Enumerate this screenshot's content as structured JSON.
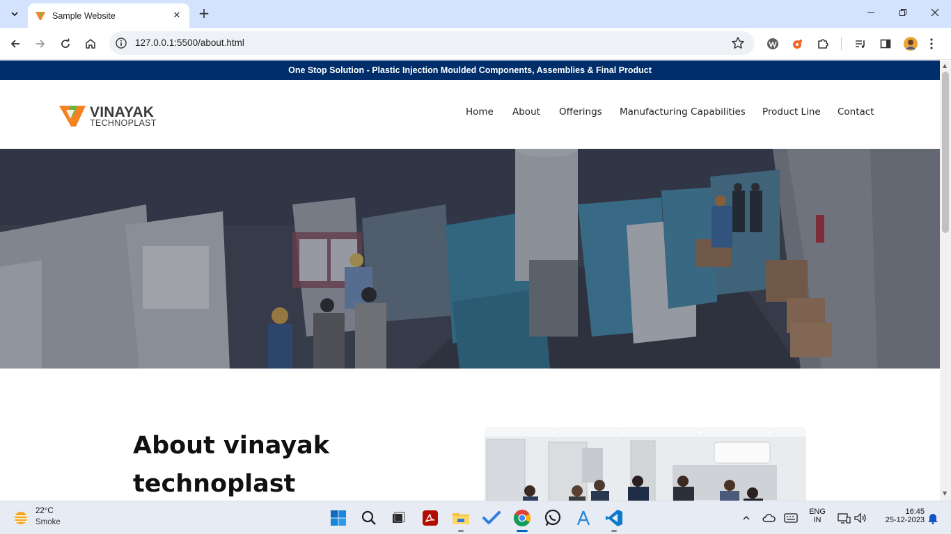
{
  "browser": {
    "tab_title": "Sample Website",
    "tab_close": "✕",
    "new_tab": "+",
    "url": "127.0.0.1:5500/about.html",
    "window_controls": {
      "minimize": "—",
      "maximize": "❐",
      "close": "✕"
    }
  },
  "site": {
    "banner": "One Stop Solution - Plastic Injection Moulded Components, Assemblies & Final Product",
    "logo_name": "VINAYAK",
    "logo_sub": "TECHNOPLAST",
    "nav": [
      "Home",
      "About",
      "Offerings",
      "Manufacturing Capabilities",
      "Product Line",
      "Contact"
    ],
    "about_title": "About vinayak technoplast",
    "colors": {
      "banner_bg": "#002e6a",
      "logo_orange": "#f58220",
      "logo_green": "#6cb33f"
    }
  },
  "taskbar": {
    "temp": "22°C",
    "condition": "Smoke",
    "lang_top": "ENG",
    "lang_bottom": "IN",
    "time": "16:45",
    "date": "25-12-2023",
    "icons": [
      "windows-start",
      "search",
      "task-view",
      "acrobat",
      "file-explorer",
      "todo",
      "chrome",
      "whatsapp",
      "app-installer",
      "vscode"
    ]
  }
}
